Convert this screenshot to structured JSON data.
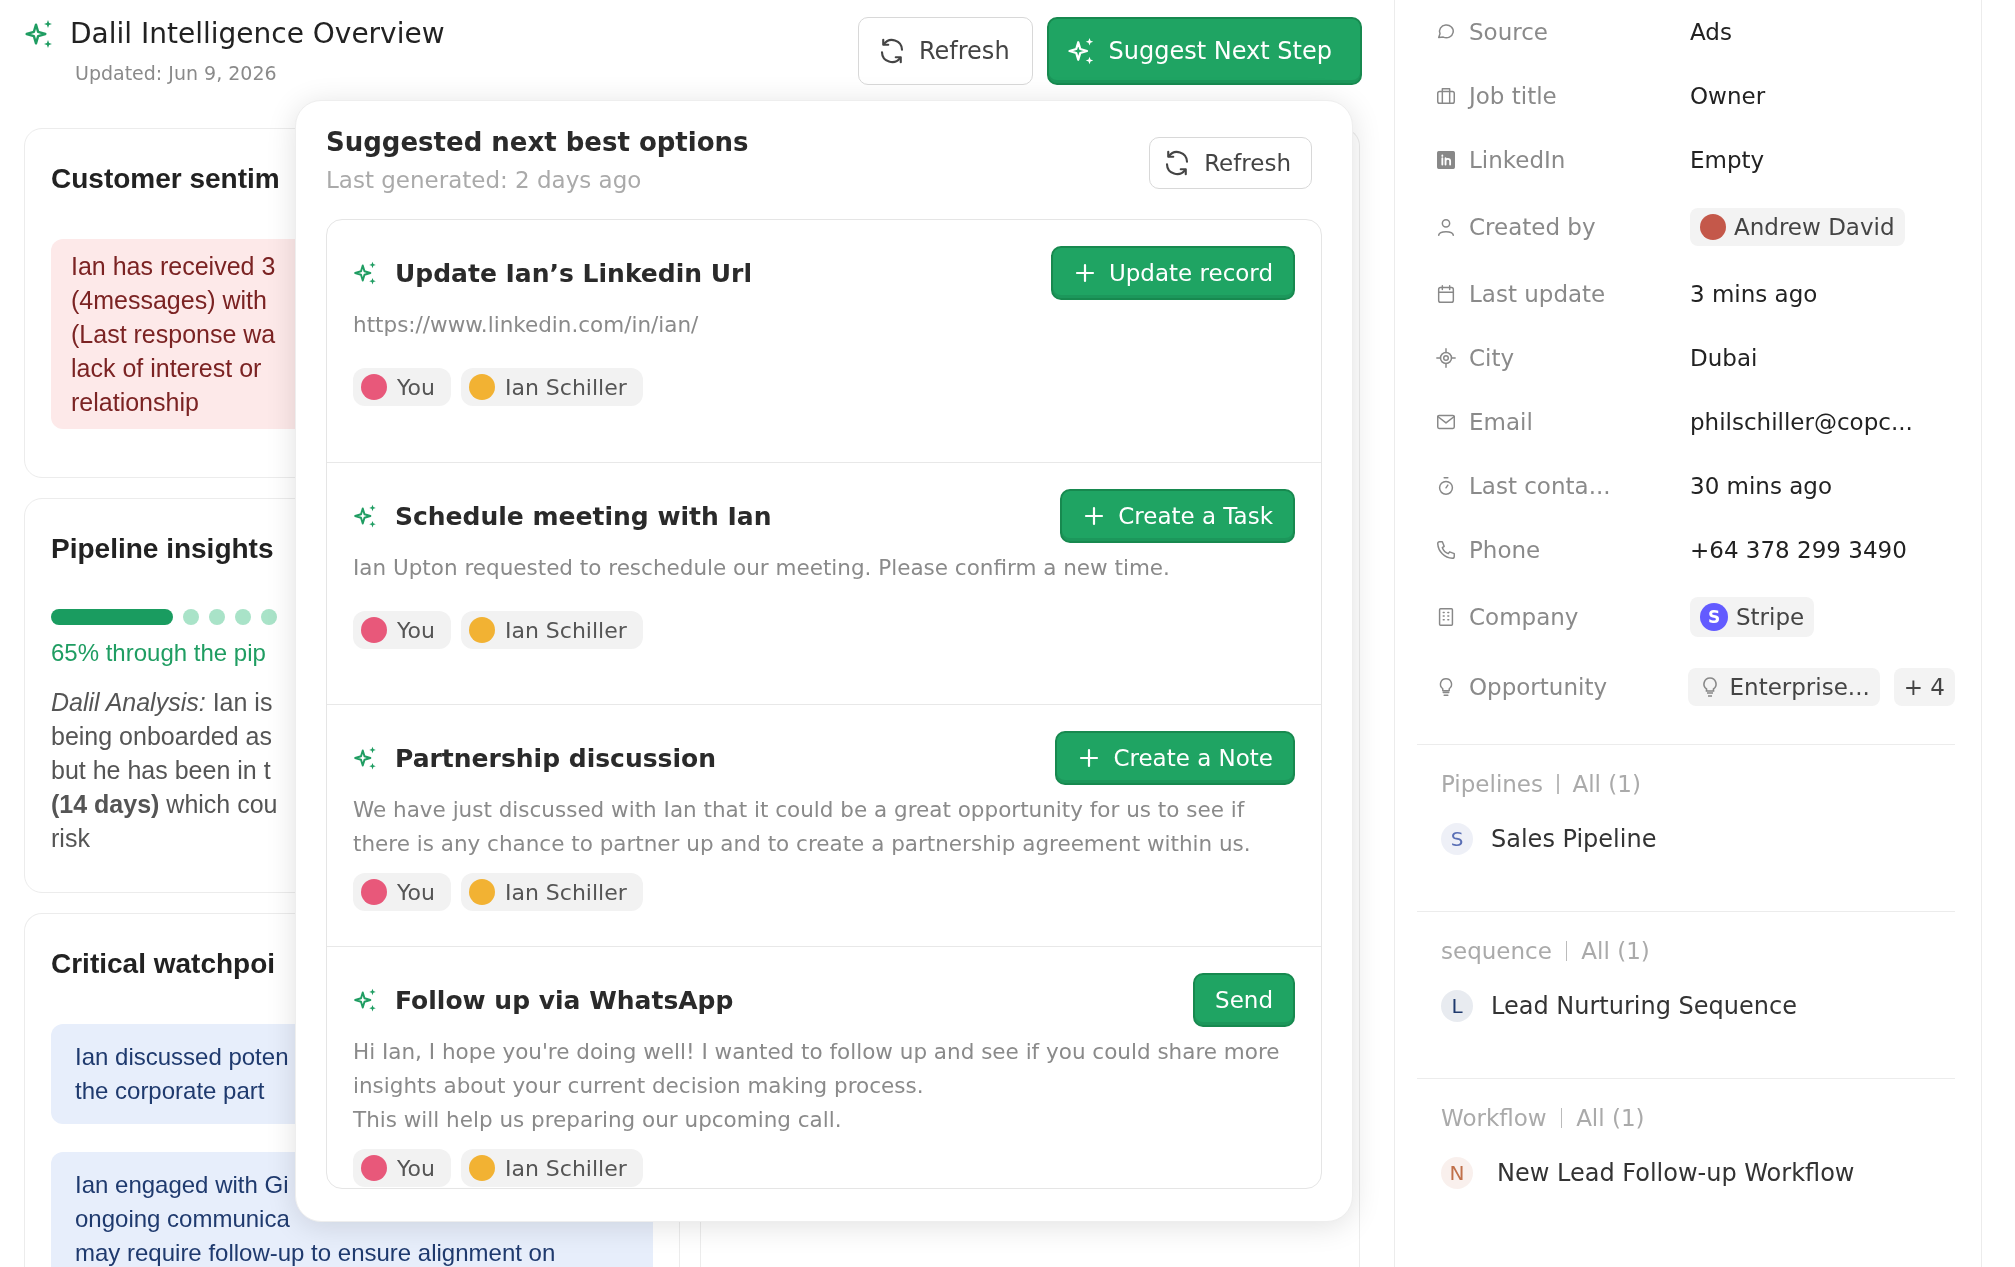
{
  "header": {
    "title": "Dalil Intelligence Overview",
    "updated": "Updated: Jun 9, 2026"
  },
  "header_buttons": [
    {
      "label": "Refresh",
      "kind": "secondary"
    },
    {
      "label": "Suggest Next Step",
      "kind": "primary"
    }
  ],
  "left_cards": [
    {
      "title": "Customer sentim",
      "kind": "alert",
      "lines": [
        "Ian has received 3",
        "(4messages) with",
        "(Last response wa",
        "lack of interest or",
        "relationship"
      ]
    },
    {
      "title": "Pipeline insights",
      "kind": "progress",
      "stages": [
        {
          "completed": true
        },
        {
          "completed": false
        },
        {
          "completed": false
        },
        {
          "completed": false
        },
        {
          "completed": false
        }
      ],
      "progress_text": "65% through the pip",
      "lines": [
        "*Dalil Analysis:* Ian is",
        "being onboarded as",
        "but he has been in t",
        "**(14 days)** which cou",
        "risk"
      ]
    },
    {
      "title": "Critical watchpoi",
      "kind": "notes",
      "notes": [
        [
          "Ian discussed poten",
          "the corporate part"
        ],
        [
          "Ian engaged with Gi",
          "ongoing communica",
          "may require follow-up to ensure alignment on"
        ]
      ]
    }
  ],
  "popup": {
    "title": "Suggested next best options",
    "subtitle": "Last generated: 2 days ago",
    "refresh_label": "Refresh",
    "options": [
      {
        "title": "Update Ian’s Linkedin Url",
        "action": "Update record",
        "action_icon": true,
        "body": [
          "https://www.linkedin.com/in/ian/"
        ],
        "people": [
          {
            "name": "You",
            "color": "#e8587a"
          },
          {
            "name": "Ian Schiller",
            "color": "#f2b233"
          }
        ]
      },
      {
        "title": "Schedule meeting with Ian",
        "action": "Create a Task",
        "action_icon": true,
        "body": [
          "Ian Upton requested to reschedule our meeting. Please confirm a new time."
        ],
        "people": [
          {
            "name": "You",
            "color": "#e8587a"
          },
          {
            "name": "Ian Schiller",
            "color": "#f2b233"
          }
        ]
      },
      {
        "title": "Partnership discussion",
        "action": "Create a Note",
        "action_icon": true,
        "body": [
          "We have just discussed with Ian that it could be a great opportunity for us to see if there is any chance to partner up and to create a partnership agreement within us."
        ],
        "people": [
          {
            "name": "You",
            "color": "#e8587a"
          },
          {
            "name": "Ian Schiller",
            "color": "#f2b233"
          }
        ]
      },
      {
        "title": "Follow up via WhatsApp",
        "action": "Send",
        "action_icon": false,
        "body": [
          "Hi Ian, I hope you're doing well! I wanted to follow up and see if you could share more insights about your current decision making process.",
          "This will help us preparing our upcoming call."
        ],
        "people": [
          {
            "name": "You",
            "color": "#e8587a"
          },
          {
            "name": "Ian Schiller",
            "color": "#f2b233"
          }
        ]
      }
    ]
  },
  "fields": [
    {
      "label": "Source",
      "kind": "text",
      "value": "Ads"
    },
    {
      "label": "Job title",
      "kind": "text",
      "value": "Owner"
    },
    {
      "label": "LinkedIn",
      "kind": "text",
      "value": "Empty"
    },
    {
      "label": "Created by",
      "kind": "person",
      "value": "Andrew David"
    },
    {
      "label": "Last update",
      "kind": "text",
      "value": "3 mins ago"
    },
    {
      "label": "City",
      "kind": "text",
      "value": "Dubai"
    },
    {
      "label": "Email",
      "kind": "text",
      "value": "philschiller@copc..."
    },
    {
      "label": "Last conta...",
      "kind": "text",
      "value": "30 mins ago"
    },
    {
      "label": "Phone",
      "kind": "text",
      "value": "+64 378 299 3490"
    },
    {
      "label": "Company",
      "kind": "company",
      "value": "Stripe",
      "logo": "S"
    },
    {
      "label": "Opportunity",
      "kind": "tags",
      "value": "Enterprise...",
      "more": "+ 4"
    }
  ],
  "sections": [
    {
      "title": "Pipelines",
      "count": "All (1)",
      "items": [
        {
          "initial": "S",
          "name": "Sales Pipeline",
          "color": "#5a6fb5"
        }
      ]
    },
    {
      "title": "sequence",
      "count": "All (1)",
      "items": [
        {
          "initial": "L",
          "name": "Lead Nurturing Sequence",
          "color": "#1f3a6e"
        }
      ]
    },
    {
      "title": "Workflow",
      "count": "All (1)",
      "items": [
        {
          "initial": "N",
          "name": "New Lead Follow-up Workflow",
          "color": "#c0704a"
        }
      ]
    }
  ]
}
